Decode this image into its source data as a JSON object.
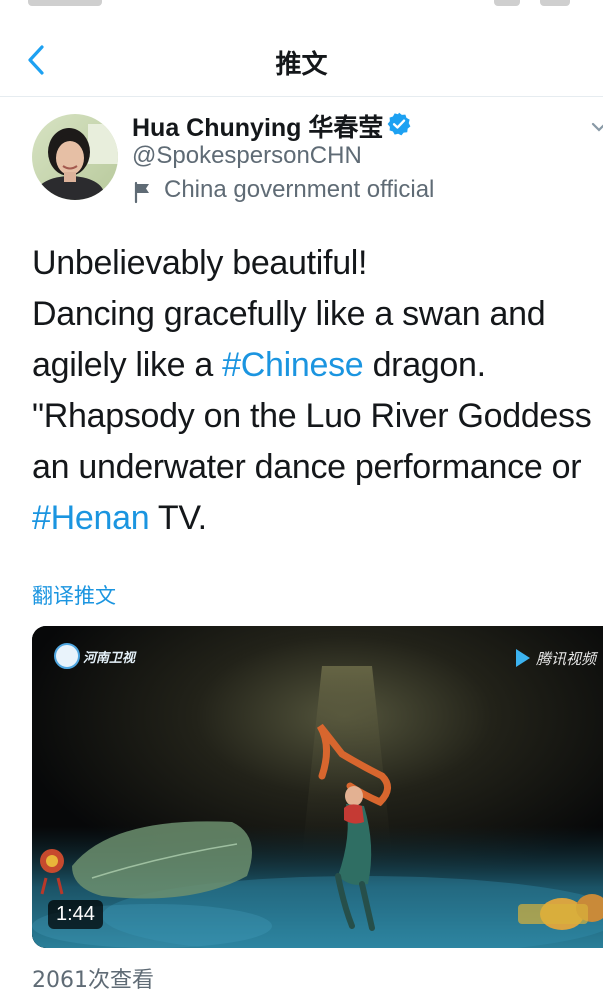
{
  "nav": {
    "title": "推文"
  },
  "author": {
    "name": "Hua Chunying 华春莹",
    "handle": "@SpokespersonCHN",
    "label": "China government official"
  },
  "tweet": {
    "lines": [
      [
        {
          "text": "Unbelievably beautiful!"
        }
      ],
      [
        {
          "text": "Dancing gracefully like a swan and"
        }
      ],
      [
        {
          "text": "agilely like a "
        },
        {
          "text": "#Chinese",
          "hashtag": true
        },
        {
          "text": " dragon."
        }
      ],
      [
        {
          "text": "\"Rhapsody on the Luo River Goddess"
        }
      ],
      [
        {
          "text": "an underwater dance performance or"
        }
      ],
      [
        {
          "text": "#Henan",
          "hashtag": true
        },
        {
          "text": " TV."
        }
      ]
    ],
    "translate_label": "翻译推文"
  },
  "media": {
    "duration": "1:44",
    "channel_logo": "河南卫视",
    "platform_logo": "腾讯视频"
  },
  "stats": {
    "views": "2061次查看"
  },
  "colors": {
    "link": "#1b95e0",
    "secondary_text": "#5f6b75",
    "primary_text": "#14171a",
    "verified": "#1da1f2"
  },
  "icons": [
    "back-chevron-icon",
    "verified-badge-icon",
    "flag-icon",
    "more-caret-icon",
    "video-thumbnail"
  ]
}
